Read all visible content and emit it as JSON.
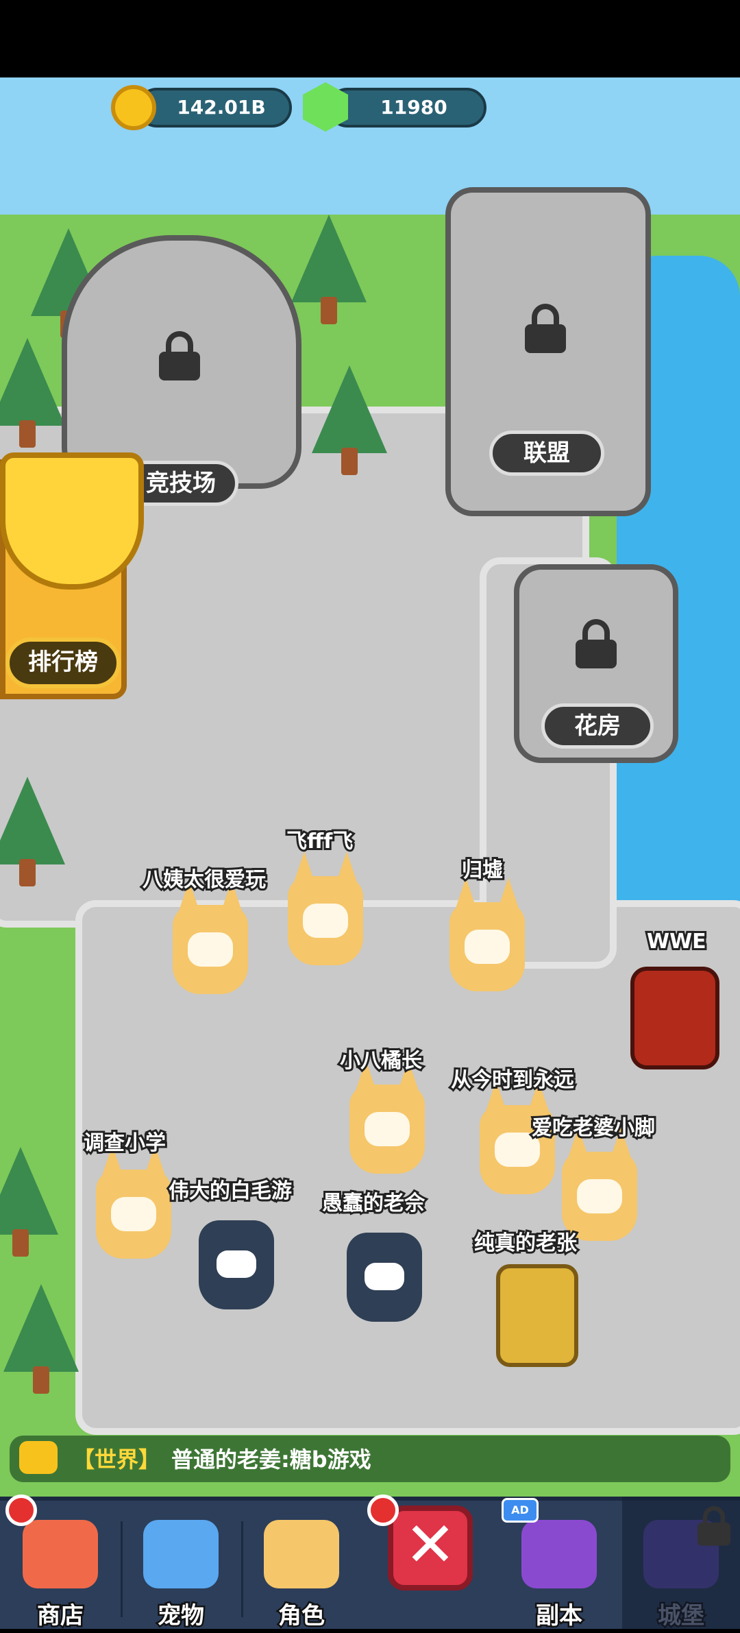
{
  "currency": {
    "coins": "142.01B",
    "gems": "11980"
  },
  "buildings": {
    "arena": "竞技场",
    "alliance": "联盟",
    "greenhouse": "花房",
    "leaderboard": "排行榜"
  },
  "players": [
    {
      "name": "飞fff飞",
      "type": "fox"
    },
    {
      "name": "八姨太很爱玩",
      "type": "fox"
    },
    {
      "name": "归墟",
      "type": "fox"
    },
    {
      "name": "WWE",
      "type": "demon"
    },
    {
      "name": "小八橘长",
      "type": "fox"
    },
    {
      "name": "从今时到永远",
      "type": "fox"
    },
    {
      "name": "爱吃老婆小脚",
      "type": "fox"
    },
    {
      "name": "调查小学",
      "type": "fox"
    },
    {
      "name": "伟大的白毛游",
      "type": "cat"
    },
    {
      "name": "愚蠢的老佘",
      "type": "cat"
    },
    {
      "name": "纯真的老张",
      "type": "knight"
    }
  ],
  "chat": {
    "channel": "【世界】",
    "message": "普通的老姜:糖b游戏"
  },
  "nav": {
    "shop": "商店",
    "pet": "宠物",
    "role": "角色",
    "close": "✕",
    "dungeon": "副本",
    "castle": "城堡",
    "ad": "AD"
  },
  "colors": {
    "accent": "#f8c21c",
    "danger": "#e03448",
    "water": "#3fb3ec",
    "grass": "#7dc95a"
  }
}
